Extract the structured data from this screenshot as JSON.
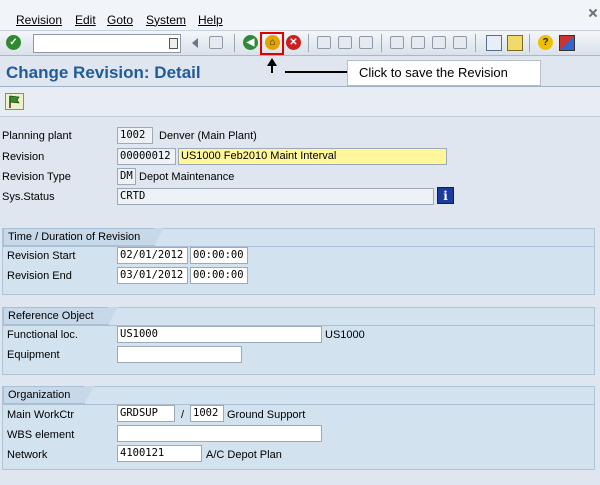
{
  "menu": {
    "items": [
      "Revision",
      "Edit",
      "Goto",
      "System",
      "Help"
    ]
  },
  "toolbar": {
    "command_value": "",
    "icons": [
      "enter-icon",
      "back-icon",
      "exit-icon",
      "cancel-icon",
      "print-icon",
      "find-icon",
      "find-next-icon",
      "first-page-icon",
      "prev-page-icon",
      "next-page-icon",
      "last-page-icon",
      "create-session-icon",
      "shortcut-icon",
      "help-icon",
      "customize-layout-icon"
    ]
  },
  "page": {
    "title": "Change Revision: Detail"
  },
  "callout": {
    "text": "Click to save the Revision"
  },
  "header_fields": {
    "planning_plant_label": "Planning plant",
    "planning_plant_value": "1002",
    "planning_plant_desc": "Denver (Main Plant)",
    "revision_label": "Revision",
    "revision_value": "00000012",
    "revision_desc": "US1000 Feb2010 Maint Interval",
    "revision_type_label": "Revision Type",
    "revision_type_value": "DM",
    "revision_type_desc": "Depot Maintenance",
    "sys_status_label": "Sys.Status",
    "sys_status_value": "CRTD"
  },
  "time_group": {
    "title": "Time / Duration of Revision",
    "start_label": "Revision Start",
    "start_date": "02/01/2012",
    "start_time": "00:00:00",
    "end_label": "Revision End",
    "end_date": "03/01/2012",
    "end_time": "00:00:00"
  },
  "reference_group": {
    "title": "Reference Object",
    "func_loc_label": "Functional loc.",
    "func_loc_value": "US1000",
    "func_loc_desc": "US1000",
    "equipment_label": "Equipment",
    "equipment_value": ""
  },
  "org_group": {
    "title": "Organization",
    "workctr_label": "Main WorkCtr",
    "workctr_value": "GRDSUP",
    "slash": "/",
    "workctr_plant": "1002",
    "workctr_desc": "Ground Support",
    "wbs_label": "WBS element",
    "wbs_value": "",
    "network_label": "Network",
    "network_value": "4100121",
    "network_desc": "A/C Depot Plan"
  },
  "colors": {
    "title": "#1f5c98",
    "highlight": "#fff79a",
    "save_box": "#e00000"
  }
}
